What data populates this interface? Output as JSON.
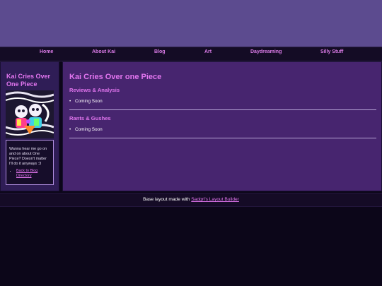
{
  "nav": {
    "items": [
      {
        "label": "Home"
      },
      {
        "label": "About Kai"
      },
      {
        "label": "Blog"
      },
      {
        "label": "Art"
      },
      {
        "label": "Daydreaming"
      },
      {
        "label": "Silly Stuff"
      }
    ]
  },
  "sidebar": {
    "title": "Kai Cries Over One Piece",
    "description": "Wanna hear me go on and on about One Piece? Doesn't matter I'll do it anyways :3",
    "link": "Back to Blog Directory"
  },
  "main": {
    "title": "Kai Cries Over one Piece",
    "sections": [
      {
        "heading": "Reviews & Analysis",
        "item": "Coming Soon"
      },
      {
        "heading": "Rants & Gushes",
        "item": "Coming Soon"
      }
    ]
  },
  "footer": {
    "text": "Base layout made with ",
    "link": "Sadgrl's Layout Builder"
  },
  "colors": {
    "header_bg": "#5c4b8f",
    "accent": "#e376f0",
    "main_bg": "#47256f",
    "sidebar_bg": "#2f1d56",
    "page_bg": "#0c0619"
  }
}
